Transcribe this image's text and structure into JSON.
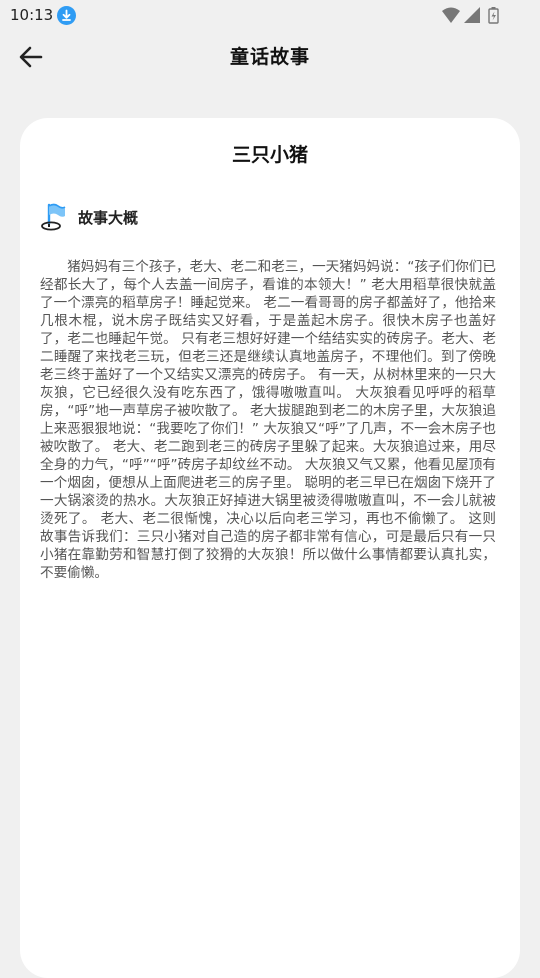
{
  "status_bar": {
    "time": "10:13",
    "icons": [
      "download-icon",
      "wifi-icon",
      "signal-icon",
      "battery-icon"
    ]
  },
  "header": {
    "title": "童话故事",
    "back_icon": "arrow-left-icon"
  },
  "story": {
    "title": "三只小猪",
    "section_label": "故事大概",
    "section_icon": "flag-icon",
    "body": "猪妈妈有三个孩子，老大、老二和老三，一天猪妈妈说：“孩子们你们已经都长大了，每个人去盖一间房子，看谁的本领大！”        老大用稻草很快就盖了一个漂亮的稻草房子！睡起觉来。        老二一看哥哥的房子都盖好了，他拾来几根木棍，说木房子既结实又好看，于是盖起木房子。很快木房子也盖好了，老二也睡起午觉。        只有老三想好好建一个结结实实的砖房子。老大、老二睡醒了来找老三玩，但老三还是继续认真地盖房子，不理他们。到了傍晚老三终于盖好了一个又结实又漂亮的砖房子。                有一天，从树林里来的一只大灰狼，它已经很久没有吃东西了，饿得嗷嗷直叫。        大灰狼看见呼呼的稻草房，“呼”地一声草房子被吹散了。        老大拔腿跑到老二的木房子里，大灰狼追上来恶狠狠地说：“我要吃了你们！”        大灰狼又“呼”了几声，不一会木房子也被吹散了。        老大、老二跑到老三的砖房子里躲了起来。大灰狼追过来，用尽全身的力气，“呼”“呼”砖房子却纹丝不动。        大灰狼又气又累，他看见屋顶有一个烟囱，便想从上面爬进老三的房子里。        聪明的老三早已在烟囱下烧开了一大锅滚烫的热水。大灰狼正好掉进大锅里被烫得嗷嗷直叫，不一会儿就被烫死了。        老大、老二很惭愧，决心以后向老三学习，再也不偷懒了。        这则故事告诉我们：三只小猪对自己造的房子都非常有信心，可是最后只有一只小猪在靠勤劳和智慧打倒了狡猾的大灰狼！所以做什么事情都要认真扎实，不要偷懒。"
  },
  "colors": {
    "background": "#f0f0f0",
    "card": "#ffffff",
    "accent_blue": "#2f9cf4",
    "body_text": "#555555"
  }
}
